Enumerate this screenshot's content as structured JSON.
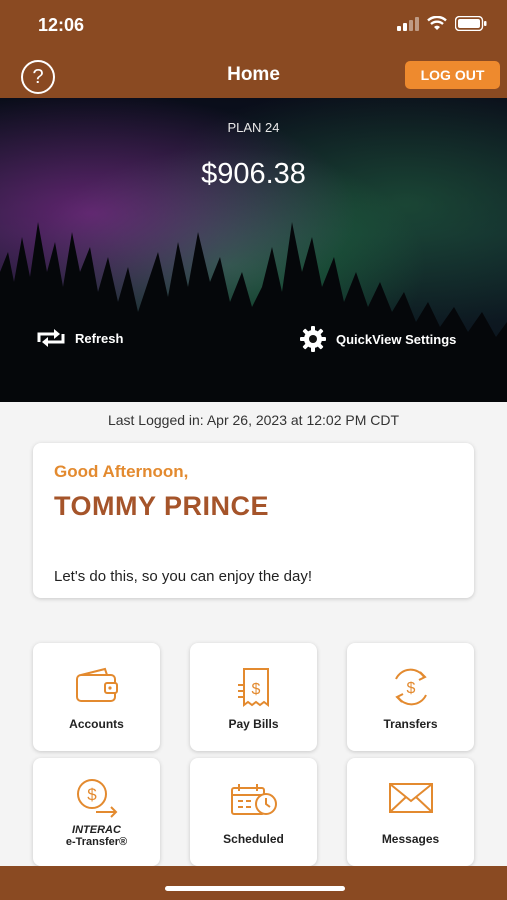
{
  "status": {
    "time": "12:06"
  },
  "nav": {
    "title": "Home",
    "help_label": "?",
    "logout_label": "LOG OUT"
  },
  "hero": {
    "plan_label": "PLAN 24",
    "balance": "$906.38",
    "refresh_label": "Refresh",
    "quickview_label": "QuickView Settings"
  },
  "last_logged": "Last Logged in: Apr 26, 2023 at 12:02 PM  CDT",
  "greeting": {
    "salutation": "Good Afternoon,",
    "name": "TOMMY PRINCE",
    "message": "Let's do this, so you can enjoy the day!"
  },
  "tiles": [
    {
      "label": "Accounts",
      "icon": "wallet-icon"
    },
    {
      "label": "Pay Bills",
      "icon": "bill-icon"
    },
    {
      "label": "Transfers",
      "icon": "transfer-icon"
    },
    {
      "label_line1": "INTERAC",
      "label_line2": "e-Transfer®",
      "icon": "e-transfer-icon"
    },
    {
      "label": "Scheduled",
      "icon": "calendar-clock-icon"
    },
    {
      "label": "Messages",
      "icon": "envelope-icon"
    }
  ],
  "colors": {
    "brand_brown": "#8a4a22",
    "accent_orange": "#ee8a2e",
    "icon_orange": "#e38a2f",
    "name_brown": "#a5542a"
  }
}
